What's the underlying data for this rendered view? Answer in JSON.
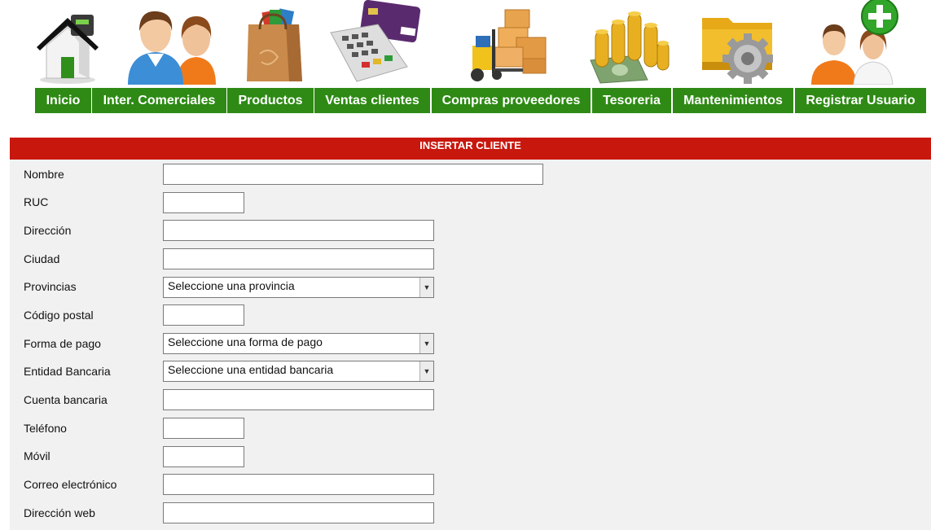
{
  "nav": {
    "items": [
      {
        "label": "Inicio",
        "icon": "house-icon"
      },
      {
        "label": "Inter. Comerciales",
        "icon": "people-icon"
      },
      {
        "label": "Productos",
        "icon": "shopping-bag-icon"
      },
      {
        "label": "Ventas clientes",
        "icon": "card-terminal-icon"
      },
      {
        "label": "Compras proveedores",
        "icon": "forklift-boxes-icon"
      },
      {
        "label": "Tesoreria",
        "icon": "coins-money-icon"
      },
      {
        "label": "Mantenimientos",
        "icon": "folder-gear-icon"
      },
      {
        "label": "Registrar Usuario",
        "icon": "add-user-icon"
      }
    ],
    "accent_color": "#2e8a14"
  },
  "form": {
    "title": "INSERTAR CLIENTE",
    "header_color": "#c8170d",
    "fields": {
      "nombre": {
        "label": "Nombre",
        "value": ""
      },
      "ruc": {
        "label": "RUC",
        "value": ""
      },
      "direccion": {
        "label": "Dirección",
        "value": ""
      },
      "ciudad": {
        "label": "Ciudad",
        "value": ""
      },
      "provincias": {
        "label": "Provincias",
        "selected": "Seleccione una provincia"
      },
      "codigo_postal": {
        "label": "Código postal",
        "value": ""
      },
      "forma_pago": {
        "label": "Forma de pago",
        "selected": "Seleccione una forma de pago"
      },
      "entidad_bancaria": {
        "label": "Entidad Bancaria",
        "selected": "Seleccione una entidad bancaria"
      },
      "cuenta_bancaria": {
        "label": "Cuenta bancaria",
        "value": ""
      },
      "telefono": {
        "label": "Teléfono",
        "value": ""
      },
      "movil": {
        "label": "Móvil",
        "value": ""
      },
      "correo": {
        "label": "Correo electrónico",
        "value": ""
      },
      "web": {
        "label": "Dirección web",
        "value": ""
      }
    }
  }
}
